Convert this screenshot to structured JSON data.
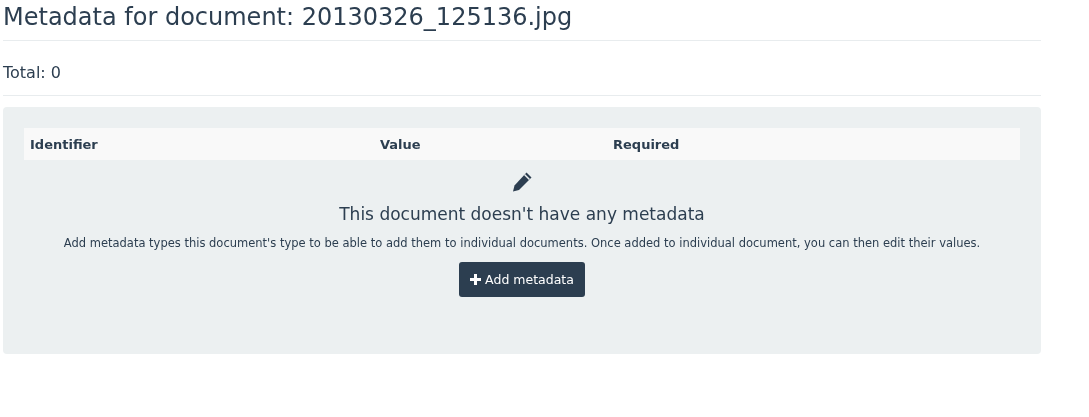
{
  "title": "Metadata for document: 20130326_125136.jpg",
  "total": "Total: 0",
  "table": {
    "columns": [
      "Identifier",
      "Value",
      "Required"
    ]
  },
  "empty_state": {
    "heading": "This document doesn't have any metadata",
    "text": "Add metadata types this document's type to be able to add them to individual documents. Once added to individual document, you can then edit their values.",
    "button": "Add metadata"
  }
}
